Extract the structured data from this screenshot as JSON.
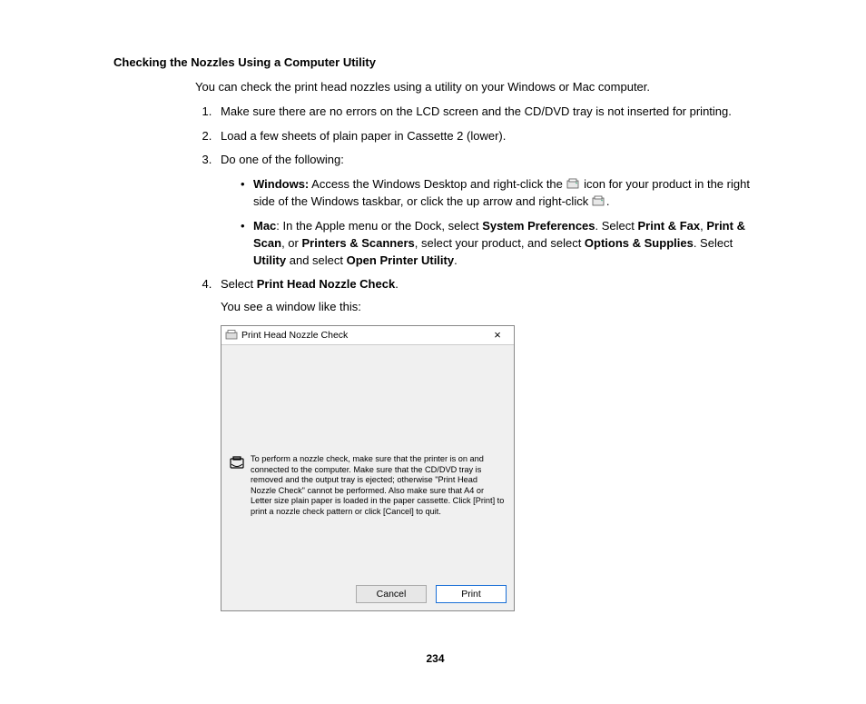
{
  "heading": "Checking the Nozzles Using a Computer Utility",
  "intro": "You can check the print head nozzles using a utility on your Windows or Mac computer.",
  "steps": {
    "s1": "Make sure there are no errors on the LCD screen and the CD/DVD tray is not inserted for printing.",
    "s2": "Load a few sheets of plain paper in Cassette 2 (lower).",
    "s3": "Do one of the following:",
    "win": {
      "label": "Windows:",
      "t1": " Access the Windows Desktop and right-click the ",
      "t2": " icon for your product in the right side of the Windows taskbar, or click the up arrow and right-click ",
      "t3": "."
    },
    "mac": {
      "label": "Mac",
      "t1": ": In the Apple menu or the Dock, select ",
      "b1": "System Preferences",
      "t2": ". Select ",
      "b2": "Print & Fax",
      "t3": ", ",
      "b3": "Print & Scan",
      "t4": ", or ",
      "b4": "Printers & Scanners",
      "t5": ", select your product, and select ",
      "b5": "Options & Supplies",
      "t6": ". Select ",
      "b6": "Utility",
      "t7": " and select ",
      "b7": "Open Printer Utility",
      "t8": "."
    },
    "s4a": "Select ",
    "s4b": "Print Head Nozzle Check",
    "s4c": ".",
    "s4after": "You see a window like this:"
  },
  "dialog": {
    "title": "Print Head Nozzle Check",
    "info": "To perform a nozzle check, make sure that the printer is on and connected to the computer. Make sure that the CD/DVD tray is removed and the output tray is ejected; otherwise \"Print Head Nozzle Check\" cannot be performed. Also make sure that A4 or Letter size plain paper is loaded in the paper cassette. Click [Print] to print a nozzle check pattern or click [Cancel] to quit.",
    "cancel": "Cancel",
    "print": "Print"
  },
  "page": "234"
}
